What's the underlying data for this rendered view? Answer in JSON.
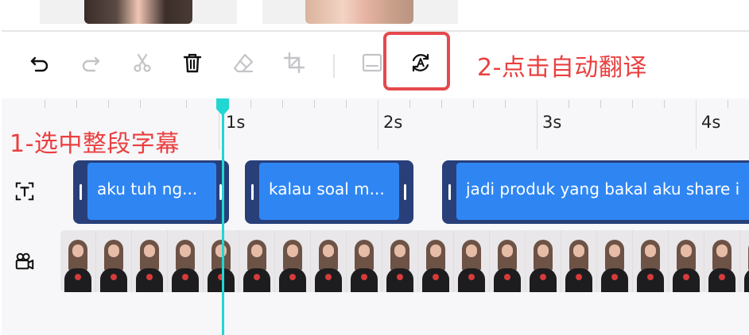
{
  "toolbar": {
    "tools": [
      {
        "name": "undo-icon",
        "enabled": true
      },
      {
        "name": "redo-icon",
        "enabled": false
      },
      {
        "name": "scissors-icon",
        "enabled": false
      },
      {
        "name": "trash-icon",
        "enabled": true
      },
      {
        "name": "eraser-icon",
        "enabled": false
      },
      {
        "name": "crop-icon",
        "enabled": false
      },
      {
        "name": "subtitle-icon",
        "enabled": false
      },
      {
        "name": "auto-translate-icon",
        "enabled": true
      }
    ]
  },
  "annotations": {
    "step1": "1-选中整段字幕",
    "step2": "2-点击自动翻译"
  },
  "ruler": {
    "labels": [
      "1s",
      "2s",
      "3s",
      "4s"
    ]
  },
  "tracks": {
    "text_track_icon": "text-track-icon",
    "video_track_icon": "video-track-icon",
    "captions": [
      {
        "text": "aku tuh ng..."
      },
      {
        "text": "kalau soal m..."
      },
      {
        "text": "jadi produk yang bakal aku share i"
      }
    ]
  },
  "colors": {
    "accent": "#2f86f3",
    "clip_border": "#283f7a",
    "playhead": "#22d6d2",
    "annotation": "#ea3f3f"
  }
}
